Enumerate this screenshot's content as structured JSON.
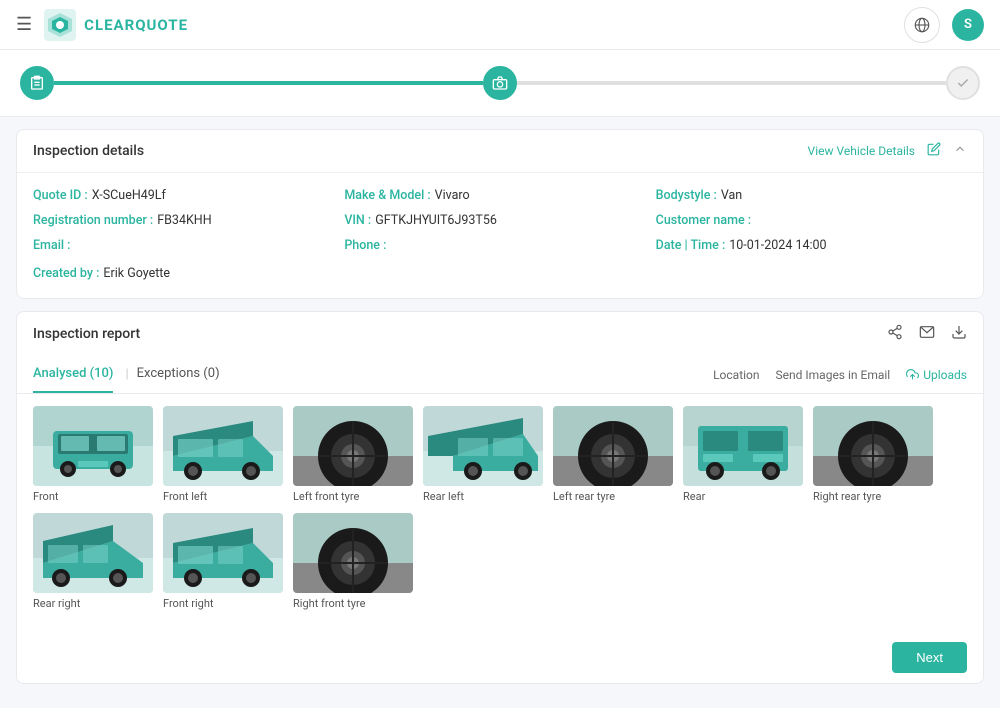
{
  "header": {
    "hamburger_label": "☰",
    "logo_text": "CLEARQUOTE",
    "globe_icon": "🌐",
    "user_initial": "S"
  },
  "progress": {
    "step1_icon": "📋",
    "step2_icon": "📷",
    "check_icon": "✓"
  },
  "inspection_details": {
    "title": "Inspection details",
    "view_vehicle_link": "View Vehicle Details",
    "quote_id_label": "Quote ID :",
    "quote_id_value": "X-SCueH49Lf",
    "reg_label": "Registration number :",
    "reg_value": "FB34KHH",
    "email_label": "Email :",
    "email_value": "",
    "make_model_label": "Make & Model :",
    "make_model_value": "Vivaro",
    "vin_label": "VIN :",
    "vin_value": "GFTKJHYUIT6J93T56",
    "phone_label": "Phone :",
    "phone_value": "",
    "bodystyle_label": "Bodystyle :",
    "bodystyle_value": "Van",
    "customer_name_label": "Customer name :",
    "customer_name_value": "",
    "date_time_label": "Date | Time :",
    "date_time_value": "10-01-2024 14:00",
    "created_by_label": "Created by :",
    "created_by_value": "Erik Goyette"
  },
  "inspection_report": {
    "title": "Inspection report"
  },
  "tabs": {
    "analysed_label": "Analysed (10)",
    "exceptions_label": "Exceptions (0)",
    "location_label": "Location",
    "send_images_label": "Send Images in Email",
    "uploads_label": "Uploads"
  },
  "images": [
    {
      "label": "Front"
    },
    {
      "label": "Front left"
    },
    {
      "label": "Left front tyre"
    },
    {
      "label": "Rear left"
    },
    {
      "label": "Left rear tyre"
    },
    {
      "label": "Rear"
    },
    {
      "label": "Right rear tyre"
    },
    {
      "label": "Rear right"
    },
    {
      "label": "Front right"
    },
    {
      "label": "Right front tyre"
    }
  ],
  "bottom": {
    "next_label": "Next"
  }
}
